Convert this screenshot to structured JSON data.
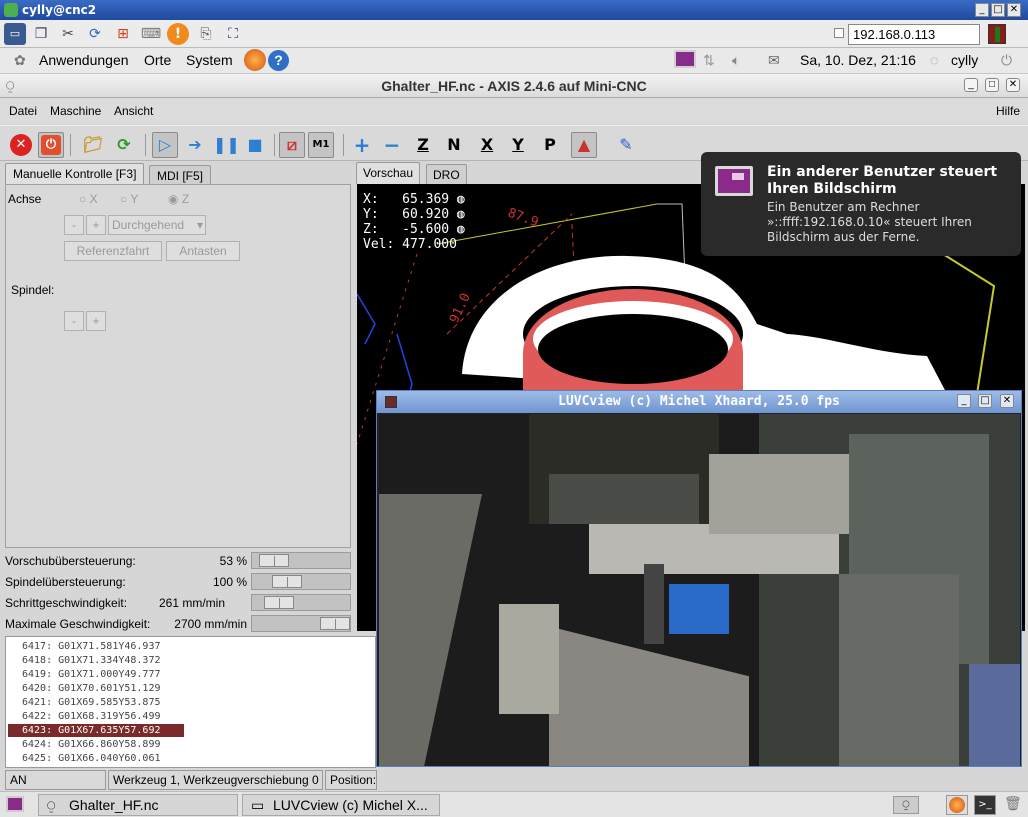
{
  "vnc": {
    "title": "cylly@cnc2",
    "address": "192.168.0.113",
    "minimize": "_",
    "maximize": "□",
    "close": "✕"
  },
  "panel": {
    "applications": "Anwendungen",
    "places": "Orte",
    "system": "System",
    "datetime": "Sa, 10. Dez, 21:16",
    "user": "cylly"
  },
  "axis": {
    "title": "Ghalter_HF.nc - AXIS 2.4.6 auf  Mini-CNC",
    "menu": {
      "file": "Datei",
      "machine": "Maschine",
      "view": "Ansicht",
      "help": "Hilfe"
    },
    "toolbar": {
      "axis_z_label": "Z",
      "axis_x_label": "X",
      "axis_y_label": "Y",
      "axis_p_label": "P",
      "m1_label": "M1"
    },
    "tabs": {
      "manual": "Manuelle Kontrolle [F3]",
      "mdi": "MDI [F5]"
    },
    "manual": {
      "axis_label": "Achse",
      "radio_x": "X",
      "radio_y": "Y",
      "radio_z": "Z",
      "minus": "-",
      "plus": "+",
      "jog_mode": "Durchgehend",
      "home_button": "Referenzfahrt",
      "touch_off_button": "Antasten",
      "spindle_label": "Spindel:"
    },
    "overrides": [
      {
        "label": "Vorschubübersteuerung:",
        "value": "53 %",
        "level": 0.53
      },
      {
        "label": "Spindelübersteuerung:",
        "value": "100 %",
        "level": 1.0
      },
      {
        "label": "Schrittgeschwindigkeit:",
        "value": "261 mm/min",
        "level": 0.1
      },
      {
        "label": "Maximale Geschwindigkeit:",
        "value": "2700 mm/min",
        "level": 1.0
      }
    ],
    "code_lines": [
      {
        "n": "6417:",
        "code": "G01X71.581Y46.937"
      },
      {
        "n": "6418:",
        "code": "G01X71.334Y48.372"
      },
      {
        "n": "6419:",
        "code": "G01X71.000Y49.777"
      },
      {
        "n": "6420:",
        "code": "G01X70.601Y51.129"
      },
      {
        "n": "6421:",
        "code": "G01X69.585Y53.875"
      },
      {
        "n": "6422:",
        "code": "G01X68.319Y56.499"
      },
      {
        "n": "6423:",
        "code": "G01X67.635Y57.692"
      },
      {
        "n": "6424:",
        "code": "G01X66.860Y58.899"
      },
      {
        "n": "6425:",
        "code": "G01X66.040Y60.061"
      }
    ],
    "selected_line_index": 6,
    "status": {
      "state": "AN",
      "tool": "Werkzeug 1, Werkzeugverschiebung 0",
      "position": "Position:"
    },
    "preview_tabs": {
      "preview": "Vorschau",
      "dro": "DRO"
    },
    "dro": {
      "x_label": "X:",
      "x": "65.369",
      "y_label": "Y:",
      "y": "60.920",
      "z_label": "Z:",
      "z": "-5.600",
      "vel_label": "Vel:",
      "vel": "477.000"
    },
    "dimension_labels": {
      "top": "87.9",
      "left": "91.0"
    }
  },
  "notification": {
    "title": "Ein anderer Benutzer steuert Ihren Bildschirm",
    "body": "Ein Benutzer am Rechner »::ffff:192.168.0.10« steuert Ihren Bildschirm aus der Ferne."
  },
  "luvc": {
    "title": "LUVCview (c) Michel Xhaard, 25.0 fps"
  },
  "taskbar": {
    "task1": "Ghalter_HF.nc",
    "task2": "LUVCview (c) Michel X..."
  },
  "colors": {
    "selected_line": "#7a2a2a",
    "cut_red": "#e05a5a",
    "toolpath": "#cc3333",
    "boundary": "#c8c830",
    "notification_bg": "#2a2a2a"
  }
}
